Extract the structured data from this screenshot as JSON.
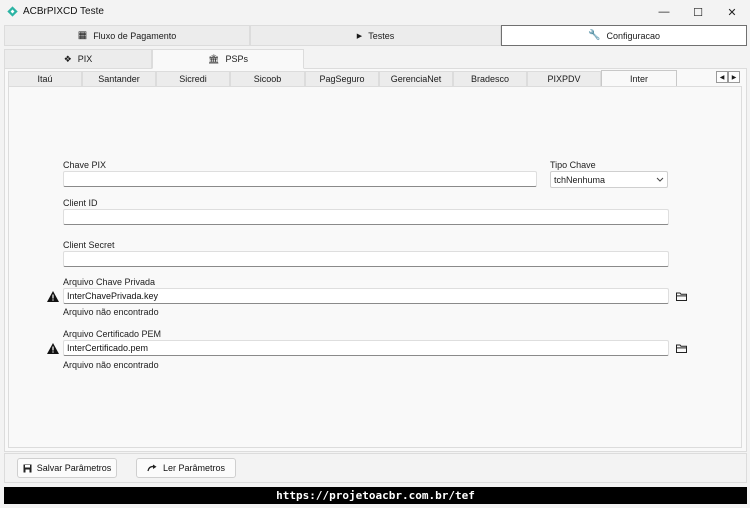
{
  "window": {
    "title": "ACBrPIXCD Teste",
    "minimize": "—",
    "maximize": "☐",
    "close": "✕"
  },
  "top_tabs": [
    {
      "label": "Fluxo de Pagamento",
      "icon": "qr-code-icon",
      "glyph": "▦"
    },
    {
      "label": "Testes",
      "icon": "play-icon",
      "glyph": "▶"
    },
    {
      "label": "Configuracao",
      "icon": "wrench-icon",
      "glyph": "🔧"
    }
  ],
  "sub_tabs": [
    {
      "label": "PIX",
      "icon": "pix-icon",
      "glyph": "❖"
    },
    {
      "label": "PSPs",
      "icon": "bank-icon",
      "glyph": "🏛"
    }
  ],
  "psp_tabs": [
    "Itaú",
    "Santander",
    "Sicredi",
    "Sicoob",
    "PagSeguro",
    "GerenciaNet",
    "Bradesco",
    "PIXPDV",
    "Inter"
  ],
  "psp_scroll": {
    "left": "◀",
    "right": "▶"
  },
  "form": {
    "chave_pix_label": "Chave PIX",
    "chave_pix_value": "",
    "tipo_chave_label": "Tipo Chave",
    "tipo_chave_value": "tchNenhuma",
    "client_id_label": "Client ID",
    "client_id_value": "",
    "client_secret_label": "Client Secret",
    "client_secret_value": "",
    "chave_privada_label": "Arquivo Chave Privada",
    "chave_privada_value": "InterChavePrivada.key",
    "chave_privada_status": "Arquivo não encontrado",
    "certificado_label": "Arquivo Certificado PEM",
    "certificado_value": "InterCertificado.pem",
    "certificado_status": "Arquivo não encontrado"
  },
  "buttons": {
    "salvar": "Salvar Parâmetros",
    "ler": "Ler Parâmetros"
  },
  "footer": {
    "url": "https://projetoacbr.com.br/tef"
  },
  "colors": {
    "accent_icon": "#2bb3a3",
    "footer_bg": "#000000"
  }
}
